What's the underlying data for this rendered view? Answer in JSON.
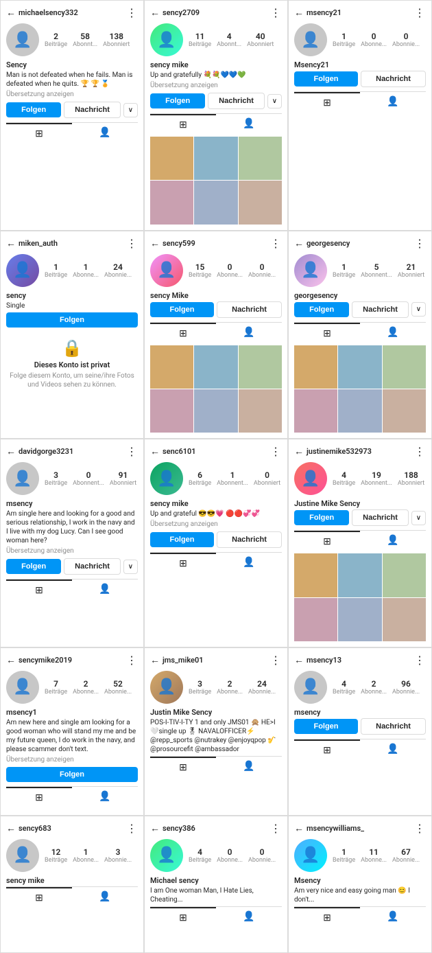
{
  "profiles": [
    {
      "id": "michaelsency332",
      "username": "michaelsency332",
      "display_name": "Sency",
      "bio": "Man is not defeated when he fails.\nMan is defeated when he quits.\n🏆 🏆 🏅",
      "has_translate": true,
      "stats": {
        "posts": "2",
        "followers": "58",
        "following": "138"
      },
      "stats_labels": [
        "Beiträge",
        "Abonnt...",
        "Abonniert"
      ],
      "avatar_color": "av-gray",
      "has_photos": false,
      "button_layout": "follow_message_dropdown",
      "is_private": false
    },
    {
      "id": "sency2709",
      "username": "sency2709",
      "display_name": "sency mike",
      "bio": "Up and gratefully 💐💐💙💙💚",
      "has_translate": true,
      "stats": {
        "posts": "11",
        "followers": "4",
        "following": "40"
      },
      "stats_labels": [
        "Beiträge",
        "Abonnt...",
        "Abonniert"
      ],
      "avatar_color": "av-dark",
      "has_photos": true,
      "button_layout": "follow_message_dropdown",
      "is_private": false
    },
    {
      "id": "msency21",
      "username": "msency21",
      "display_name": "Msency21",
      "bio": "",
      "has_translate": false,
      "stats": {
        "posts": "1",
        "followers": "0",
        "following": "0"
      },
      "stats_labels": [
        "Beiträge",
        "Abonne...",
        "Abonnie..."
      ],
      "avatar_color": "av-gray",
      "has_photos": false,
      "button_layout": "follow_message",
      "is_private": false
    },
    {
      "id": "miken_auth",
      "username": "miken_auth",
      "display_name": "sency",
      "bio": "Single",
      "has_translate": false,
      "stats": {
        "posts": "1",
        "followers": "1",
        "following": "24"
      },
      "stats_labels": [
        "Beiträge",
        "Abonne...",
        "Abonnie..."
      ],
      "avatar_color": "av-blue",
      "has_photos": false,
      "button_layout": "follow_only",
      "is_private": true,
      "private_text": "Dieses Konto ist privat",
      "private_subtext": "Folge diesem Konto, um seine/ihre\nFotos und Videos sehen zu können."
    },
    {
      "id": "sency599",
      "username": "sency599",
      "display_name": "sency Mike",
      "bio": "",
      "has_translate": false,
      "stats": {
        "posts": "15",
        "followers": "0",
        "following": "0"
      },
      "stats_labels": [
        "Beiträge",
        "Abonne...",
        "Abonnie..."
      ],
      "avatar_color": "av-orange",
      "has_photos": true,
      "button_layout": "follow_message",
      "is_private": false
    },
    {
      "id": "georgesency",
      "username": "georgesency",
      "display_name": "georgesency",
      "bio": "",
      "has_translate": false,
      "stats": {
        "posts": "1",
        "followers": "5",
        "following": "21"
      },
      "stats_labels": [
        "Beiträge",
        "Abonnent...",
        "Abonniert"
      ],
      "avatar_color": "av-purple",
      "has_photos": true,
      "button_layout": "follow_message_dropdown",
      "is_private": false
    },
    {
      "id": "davidgorge3231",
      "username": "davidgorge3231",
      "display_name": "msency",
      "bio": "Am single here and looking for a good and serious relationship, I work in the navy and I live with my dog Lucy. Can I see good woman here?",
      "has_translate": true,
      "stats": {
        "posts": "3",
        "followers": "0",
        "following": "91"
      },
      "stats_labels": [
        "Beiträge",
        "Abonnent...",
        "Abonniert"
      ],
      "avatar_color": "av-gray",
      "has_photos": false,
      "button_layout": "follow_message_dropdown",
      "is_private": false
    },
    {
      "id": "senc6101",
      "username": "senc6101",
      "display_name": "sency mike",
      "bio": "Up and grateful 😎😎💗\n🔴🔴💞💞",
      "has_translate": true,
      "stats": {
        "posts": "6",
        "followers": "1",
        "following": "0"
      },
      "stats_labels": [
        "Beiträge",
        "Abonnent...",
        "Abonniert"
      ],
      "avatar_color": "av-teal",
      "has_photos": false,
      "button_layout": "follow_message",
      "is_private": false
    },
    {
      "id": "justinemike532973",
      "username": "justinemike532973",
      "display_name": "Justine Mike Sency",
      "bio": "",
      "has_translate": false,
      "stats": {
        "posts": "4",
        "followers": "19",
        "following": "188"
      },
      "stats_labels": [
        "Beiträge",
        "Abonnent...",
        "Abonniert"
      ],
      "avatar_color": "av-red",
      "has_photos": true,
      "button_layout": "follow_message_dropdown",
      "is_private": false
    },
    {
      "id": "sencymike2019",
      "username": "sencymike2019",
      "display_name": "msency1",
      "bio": "Am new here and single am looking for a good woman who will stand my me and be my future queen, I do work in the navy, and please scammer don't text.",
      "has_translate": true,
      "stats": {
        "posts": "7",
        "followers": "2",
        "following": "52"
      },
      "stats_labels": [
        "Beiträge",
        "Abonne...",
        "Abonnie..."
      ],
      "avatar_color": "av-gray",
      "has_photos": false,
      "button_layout": "follow_only",
      "is_private": false
    },
    {
      "id": "jms_mike01",
      "username": "jms_mike01",
      "display_name": "Justin Mike Sency",
      "bio": "POS-I-TIV-I-TY 1 and only\nJMS01 🙊\nHE>I 🤍single up\n🎖 NAVALOFFICER⚡\n@repp_sports\n@nutrakey\n@enjoyqpop 🎷\n@prosourcefit\n@ambassador",
      "has_translate": false,
      "stats": {
        "posts": "3",
        "followers": "2",
        "following": "24"
      },
      "stats_labels": [
        "Beiträge",
        "Abonne...",
        "Abonnie..."
      ],
      "avatar_color": "av-brown",
      "has_photos": false,
      "button_layout": "none",
      "is_private": false
    },
    {
      "id": "msency13",
      "username": "msency13",
      "display_name": "msency",
      "bio": "",
      "has_translate": false,
      "stats": {
        "posts": "4",
        "followers": "2",
        "following": "96"
      },
      "stats_labels": [
        "Beiträge",
        "Abonne...",
        "Abonnie..."
      ],
      "avatar_color": "av-gray",
      "has_photos": false,
      "button_layout": "follow_message",
      "is_private": false
    },
    {
      "id": "sency683",
      "username": "sency683",
      "display_name": "sency mike",
      "bio": "",
      "has_translate": false,
      "stats": {
        "posts": "12",
        "followers": "1",
        "following": "3"
      },
      "stats_labels": [
        "Beiträge",
        "Abonne...",
        "Abonnie..."
      ],
      "avatar_color": "av-gray",
      "has_photos": false,
      "button_layout": "none",
      "is_private": false
    },
    {
      "id": "sency386",
      "username": "sency386",
      "display_name": "Michael sency",
      "bio": "I am One woman Man, I Hate Lies, Cheating...",
      "has_translate": false,
      "stats": {
        "posts": "4",
        "followers": "0",
        "following": "0"
      },
      "stats_labels": [
        "Beiträge",
        "Abonne...",
        "Abonnie..."
      ],
      "avatar_color": "av-dark",
      "has_photos": false,
      "button_layout": "none",
      "is_private": false
    },
    {
      "id": "msencywilliams_",
      "username": "msencywilliams_",
      "display_name": "Msency",
      "bio": "Am very nice and easy going man 😊 I don't...",
      "has_translate": false,
      "stats": {
        "posts": "1",
        "followers": "11",
        "following": "67"
      },
      "stats_labels": [
        "Beiträge",
        "Abonne...",
        "Abonnie..."
      ],
      "avatar_color": "av-green",
      "has_photos": false,
      "button_layout": "none",
      "is_private": false
    }
  ],
  "labels": {
    "follow": "Folgen",
    "message": "Nachricht",
    "translate": "Übersetzung anzeigen",
    "private_title": "Dieses Konto ist privat",
    "private_sub": "Folge diesem Konto, um seine/ihre\nFotos und Videos sehen zu können."
  }
}
